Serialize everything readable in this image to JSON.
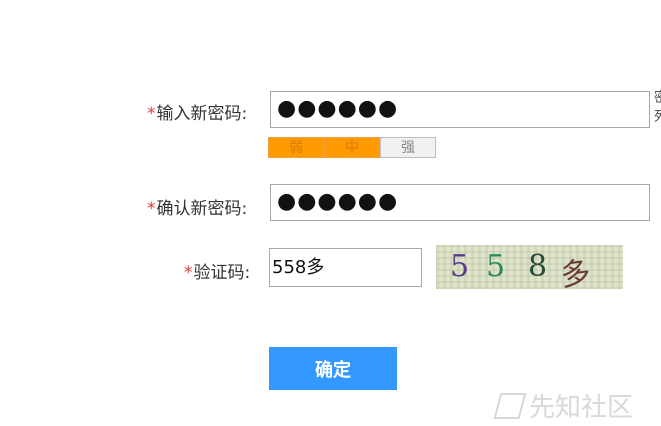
{
  "form": {
    "required_mark": "*",
    "new_password": {
      "label": "输入新密码:",
      "value": "●●●●●●"
    },
    "strength": {
      "weak": "弱",
      "medium": "中",
      "strong": "强"
    },
    "confirm_password": {
      "label": "确认新密码:",
      "value": "●●●●●●"
    },
    "captcha": {
      "label": "验证码:",
      "value": "558多",
      "image_text": [
        "5",
        "5",
        "8",
        "多"
      ]
    },
    "submit_label": "确定"
  },
  "side_clipped": [
    "密",
    "死"
  ],
  "watermark": {
    "text": "先知社区"
  },
  "colors": {
    "accent": "#3399ff",
    "required": "#e23b3b",
    "strength_active": "#ff9a00"
  }
}
